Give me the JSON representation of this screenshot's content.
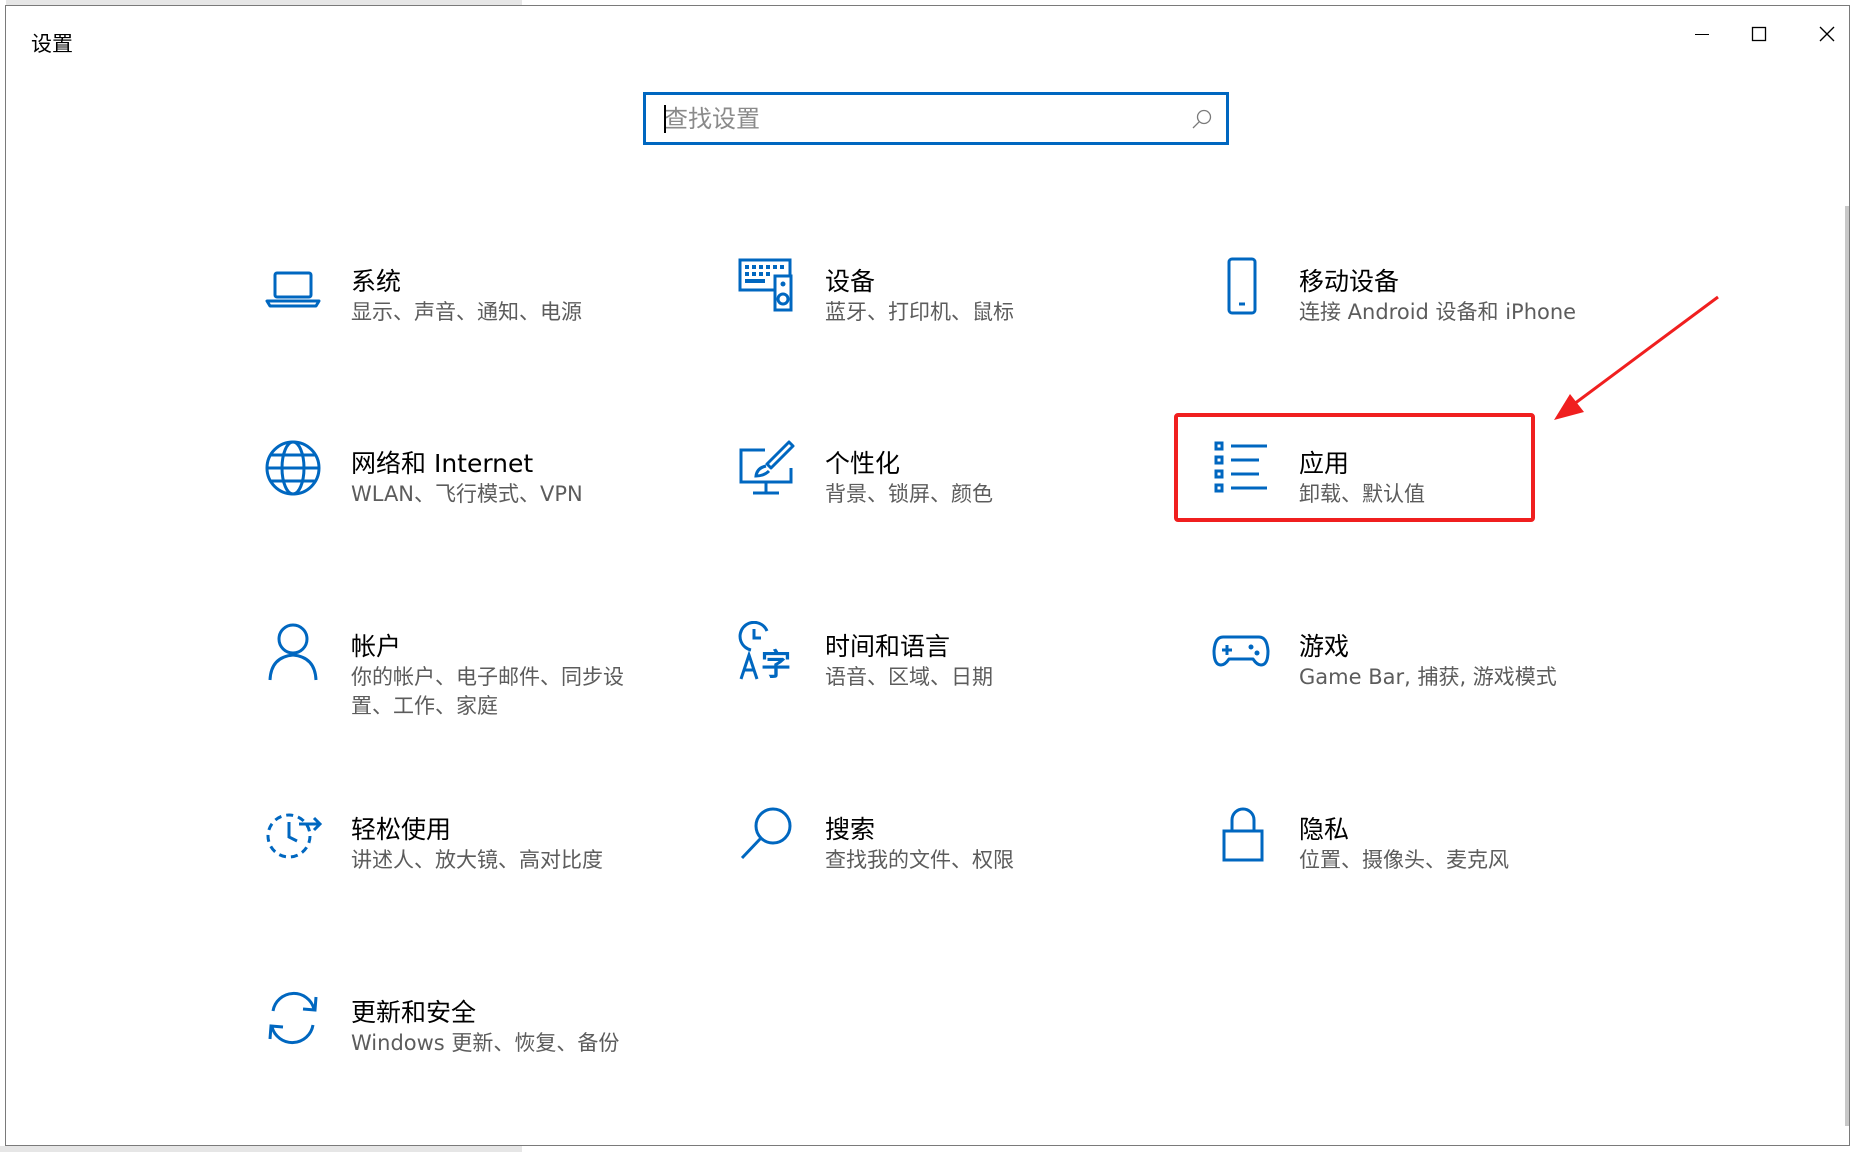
{
  "window": {
    "title": "设置",
    "controls": [
      "minimize",
      "maximize",
      "close"
    ]
  },
  "search": {
    "placeholder": "查找设置",
    "value": "",
    "icon": "search-icon"
  },
  "tiles": [
    {
      "id": "system",
      "title": "系统",
      "description": "显示、声音、通知、电源",
      "icon": "laptop-icon"
    },
    {
      "id": "devices",
      "title": "设备",
      "description": "蓝牙、打印机、鼠标",
      "icon": "devices-icon"
    },
    {
      "id": "phone",
      "title": "移动设备",
      "description": "连接 Android 设备和 iPhone",
      "icon": "phone-icon"
    },
    {
      "id": "network",
      "title": "网络和 Internet",
      "description": "WLAN、飞行模式、VPN",
      "icon": "globe-icon"
    },
    {
      "id": "personalization",
      "title": "个性化",
      "description": "背景、锁屏、颜色",
      "icon": "paint-icon"
    },
    {
      "id": "apps",
      "title": "应用",
      "description": "卸载、默认值",
      "icon": "apps-list-icon"
    },
    {
      "id": "accounts",
      "title": "帐户",
      "description": "你的帐户、电子邮件、同步设置、工作、家庭",
      "icon": "person-icon"
    },
    {
      "id": "time-language",
      "title": "时间和语言",
      "description": "语音、区域、日期",
      "icon": "time-language-icon"
    },
    {
      "id": "gaming",
      "title": "游戏",
      "description": "Game Bar, 捕获, 游戏模式",
      "icon": "gamepad-icon"
    },
    {
      "id": "ease-of-access",
      "title": "轻松使用",
      "description": "讲述人、放大镜、高对比度",
      "icon": "ease-of-access-icon"
    },
    {
      "id": "search",
      "title": "搜索",
      "description": "查找我的文件、权限",
      "icon": "magnifier-icon"
    },
    {
      "id": "privacy",
      "title": "隐私",
      "description": "位置、摄像头、麦克风",
      "icon": "lock-icon"
    },
    {
      "id": "update-security",
      "title": "更新和安全",
      "description": "Windows 更新、恢复、备份",
      "icon": "refresh-icon"
    }
  ],
  "annotation": {
    "highlighted_tile": "apps",
    "color": "#f01f1f"
  },
  "colors": {
    "accent": "#0067c0",
    "title_text": "#000000",
    "description_text": "#5c5c5c",
    "annotation": "#f01f1f"
  }
}
